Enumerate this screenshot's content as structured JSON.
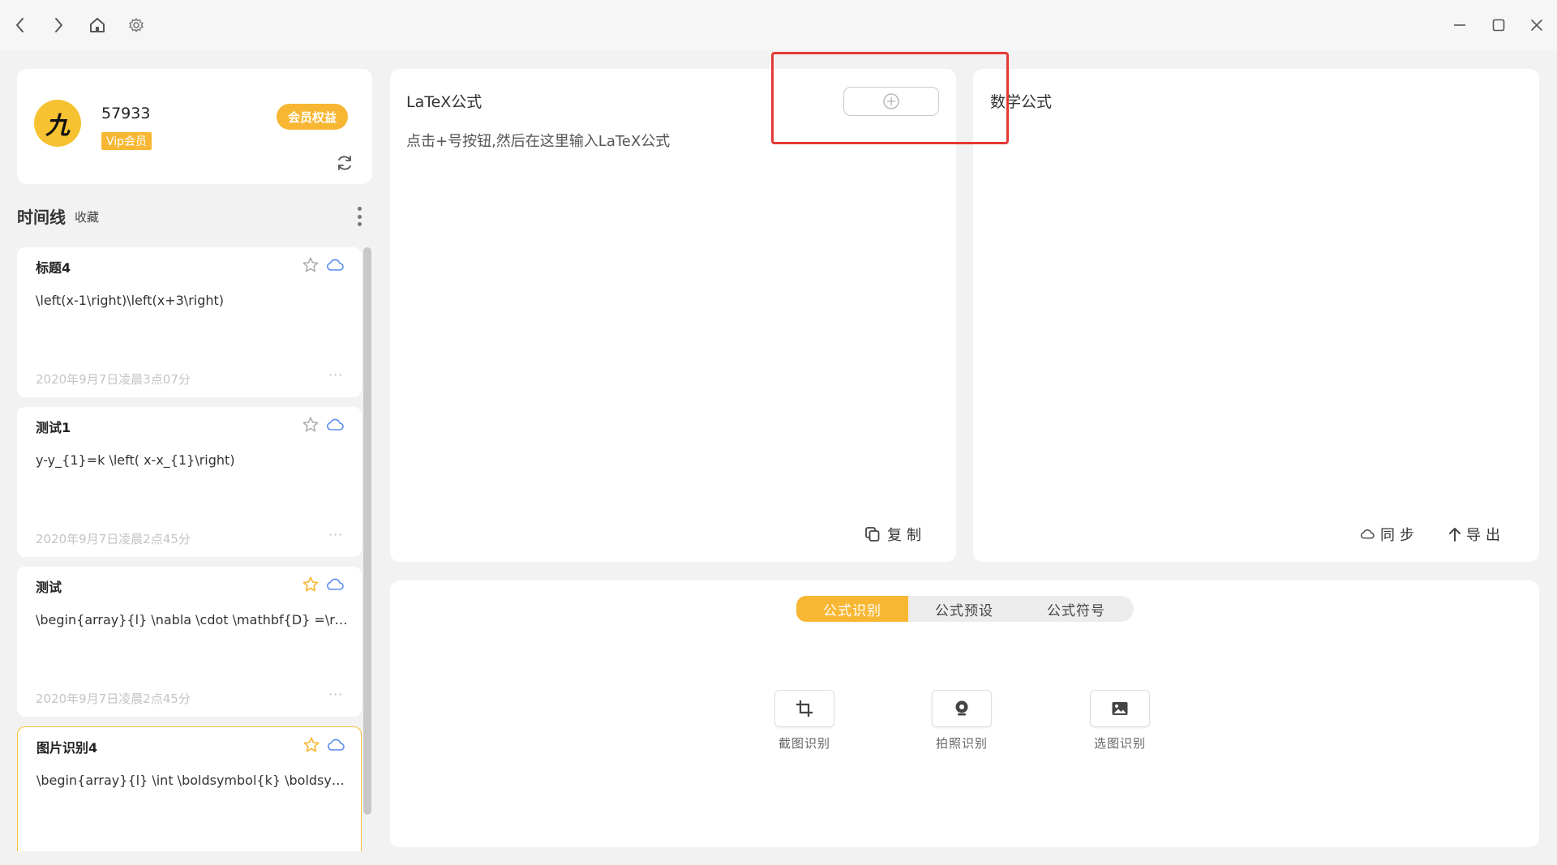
{
  "window": {
    "nav": [
      "back-icon",
      "forward-icon",
      "home-icon",
      "settings-icon"
    ],
    "controls": [
      "minimize-icon",
      "maximize-icon",
      "close-icon"
    ]
  },
  "profile": {
    "avatar_glyph": "九",
    "username": "57933",
    "vip_label": "Vip会员",
    "member_button": "会员权益"
  },
  "timeline": {
    "title": "时间线",
    "favorites": "收藏",
    "items": [
      {
        "title": "标题4",
        "formula": "\\left(x-1\\right)\\left(x+3\\right)",
        "time": "2020年9月7日凌晨3点07分",
        "starred": false
      },
      {
        "title": "测试1",
        "formula": "y-y_{1}=k \\left( x-x_{1}\\right)",
        "time": "2020年9月7日凌晨2点45分",
        "starred": false
      },
      {
        "title": "测试",
        "formula": "\\begin{array}{l} \\nabla \\cdot \\mathbf{D} =\\rho _...",
        "time": "2020年9月7日凌晨2点45分",
        "starred": true
      },
      {
        "title": "图片识别4",
        "formula": "\\begin{array}{l} \\int \\boldsymbol{k} \\boldsymbol{...",
        "time": "",
        "starred": true
      }
    ],
    "more": "···"
  },
  "latex": {
    "label": "LaTeX公式",
    "hint": "点击+号按钮,然后在这里输入LaTeX公式",
    "copy": "复制"
  },
  "math": {
    "label": "数学公式",
    "sync": "同步",
    "export": "导出"
  },
  "bottom": {
    "tabs": [
      "公式识别",
      "公式预设",
      "公式符号"
    ],
    "active_tab": 0,
    "tools": [
      "截图识别",
      "拍照识别",
      "选图识别"
    ]
  },
  "colors": {
    "accent": "#f7b733",
    "highlight": "#e53935",
    "cloud": "#5b8def"
  }
}
